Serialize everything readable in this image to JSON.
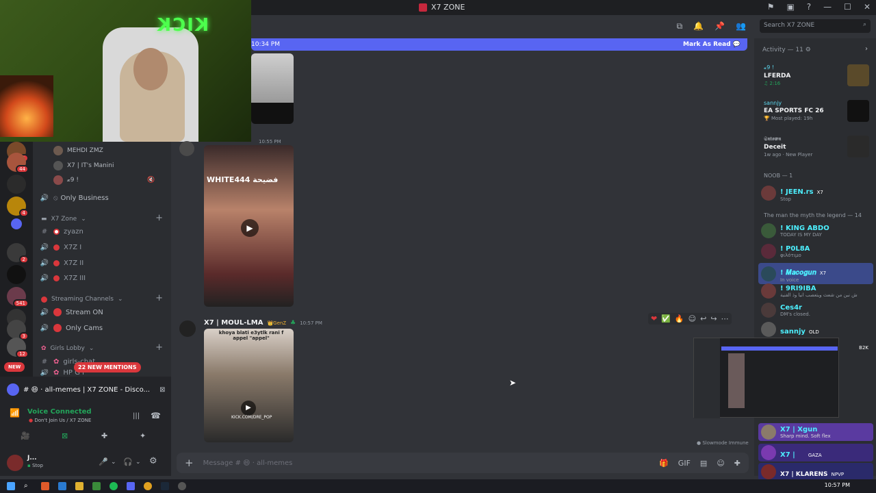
{
  "window": {
    "title": "X7 ZONE"
  },
  "search": {
    "placeholder": "Search X7 ZONE"
  },
  "new_messages_bar": {
    "time": "10:34 PM",
    "mark_label": "Mark As Read"
  },
  "voice_users": [
    {
      "name": "MEHDI ZMZ"
    },
    {
      "name": "X7 | IT's Manini"
    },
    {
      "name": "𝔁9 !"
    }
  ],
  "channels": {
    "only_business": "Only Business",
    "x7zone_category": "X7 Zone",
    "zyazn": "zyazn",
    "x7z1": "X7Z I",
    "x7z2": "X7Z II",
    "x7z3": "X7Z III",
    "streaming_category": "Streaming Channels",
    "stream_on": "Stream ON",
    "only_cams": "Only Cams",
    "girls_category": "Girls Lobby",
    "girls_chat": "girls-chat",
    "hp": "HP G I"
  },
  "mentions_label": "22 NEW MENTIONS",
  "new_label": "NEW",
  "rail_badges": [
    "1",
    "44",
    "4",
    "2",
    "541",
    "3",
    "12"
  ],
  "panel": {
    "popout_title": "# 😄 · all-memes | X7 ZONE - Disco...",
    "voice_status": "Voice Connected",
    "voice_channel": "Don't Join Us / X7 ZONE",
    "user_name": "J...",
    "user_status": "Stop"
  },
  "messages": [
    {
      "time": "10:55 PM"
    },
    {
      "author": "X7 | MOUL-LMA",
      "tag": "GenZ",
      "time": "10:57 PM",
      "caption": "khoya blati e3ytlk rani f appel \"appel\"",
      "overlay": "KICK.COM/DRE_POP"
    }
  ],
  "video_overlay_text": "WHITE444 فضيحة",
  "composer": {
    "placeholder": "Message # 😄 · all-memes"
  },
  "slowmode": "Slowmode Immune",
  "activity": {
    "header": "Activity — 11",
    "items": [
      {
        "name": "𝔁9 !",
        "game": "LFERDA",
        "sub": "2:16"
      },
      {
        "name": "sannjy",
        "game": "EA SPORTS FC 26",
        "sub": "Most played: 19h"
      },
      {
        "name": "𝕾𝖓𝖙𝖔𝖜𝖓",
        "game": "Deceit",
        "sub": "1w ago · New Player"
      }
    ]
  },
  "member_sections": [
    {
      "label": "NOOB — 1"
    },
    {
      "label": "The man the myth the legend — 14"
    }
  ],
  "members": [
    {
      "name": "! JEEN.rs",
      "tag": "X7",
      "status": "Stop"
    },
    {
      "name": "! KING ABDO",
      "status": "TODAY IS MY DAY"
    },
    {
      "name": "! P0L8A",
      "status": "φιλότιμο"
    },
    {
      "name": "! 𝑴𝒂𝒄𝒐𝒈𝒖𝒏",
      "tag": "X7",
      "status": "In voice"
    },
    {
      "name": "! 9RI9IBA",
      "status": "ش نبن من شعث ويتعصب انيا وذ القنية"
    },
    {
      "name": "Ces4r",
      "status": "DM's closed."
    },
    {
      "name": "sannjy",
      "tag": "OLD"
    },
    {
      "name": "X7 | Xgun",
      "status": "Sharp mind. Soft flex"
    },
    {
      "name": "X7 |",
      "tag": "GAZA"
    },
    {
      "name": "X7 | KLARENS",
      "tag": "NPVP"
    }
  ],
  "pip_tag": "B2K",
  "taskbar": {
    "clock": "10:57 PM"
  }
}
